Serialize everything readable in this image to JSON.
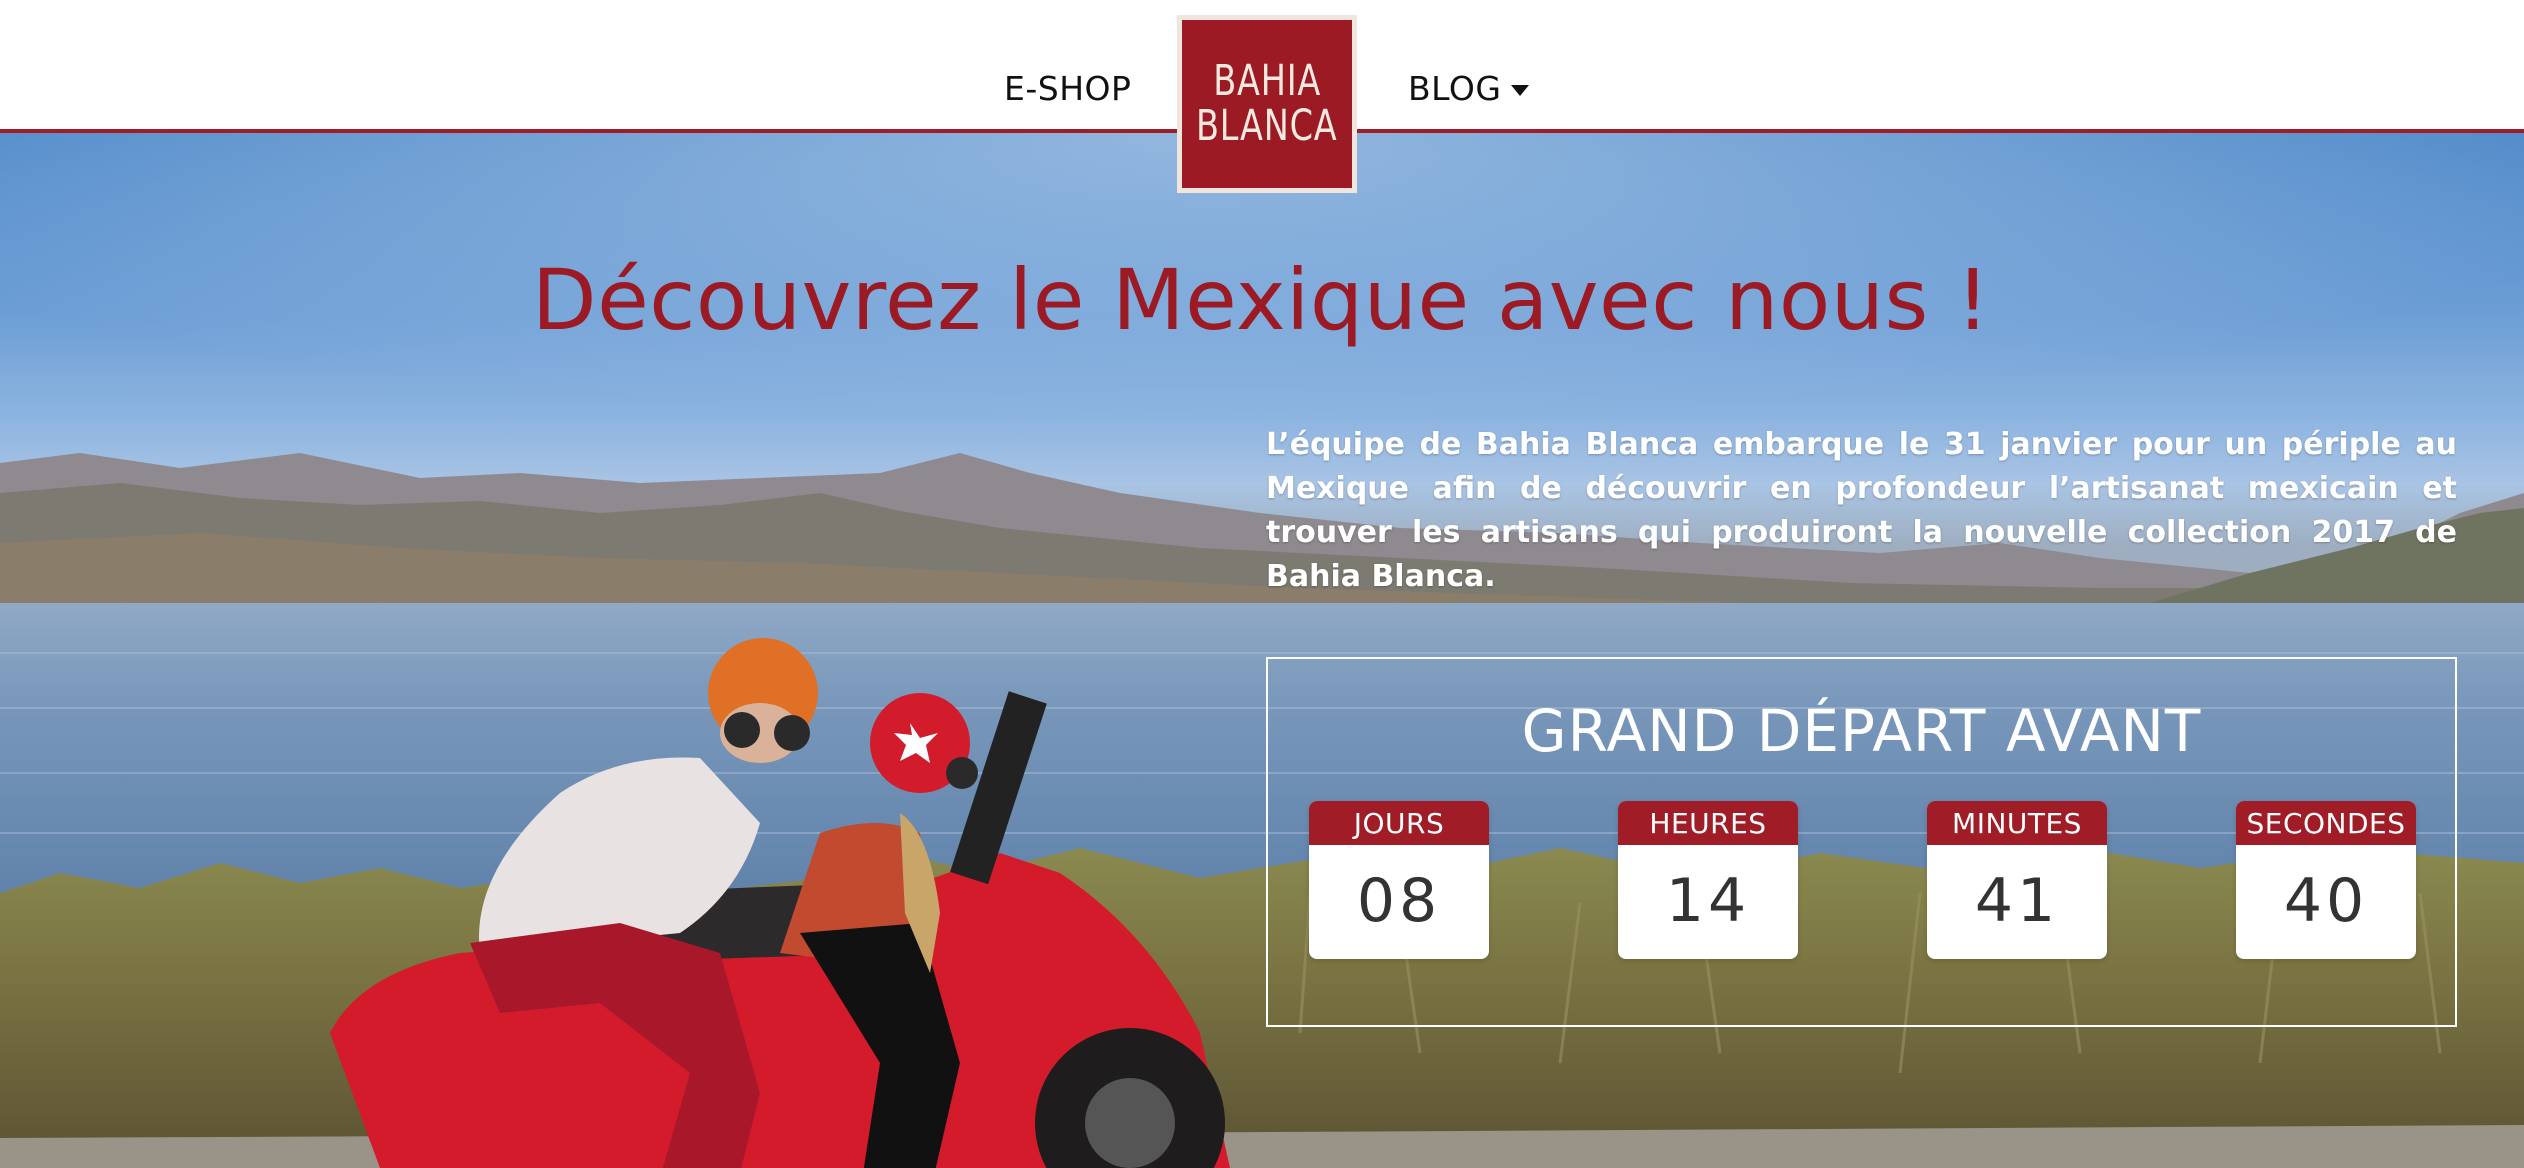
{
  "nav": {
    "eshop": "E-SHOP",
    "blog": "BLOG",
    "logo_line1": "BAHIA",
    "logo_line2": "BLANCA"
  },
  "hero": {
    "title": "Découvrez le Mexique avec nous !",
    "description": "L’équipe de Bahia Blanca embarque le 31 janvier pour un périple au Mexique afin de découvrir en profondeur l’artisanat mexicain et trouver les artisans qui produiront la nouvelle collection 2017 de Bahia Blanca."
  },
  "countdown": {
    "title": "GRAND DÉPART AVANT",
    "units": [
      {
        "label": "JOURS",
        "value": "08"
      },
      {
        "label": "HEURES",
        "value": "14"
      },
      {
        "label": "MINUTES",
        "value": "41"
      },
      {
        "label": "SECONDES",
        "value": "40"
      }
    ]
  },
  "colors": {
    "brand_red": "#a01c26",
    "logo_cream": "#f1e6dd"
  },
  "icons": {
    "blog_caret": "caret-down-icon"
  }
}
